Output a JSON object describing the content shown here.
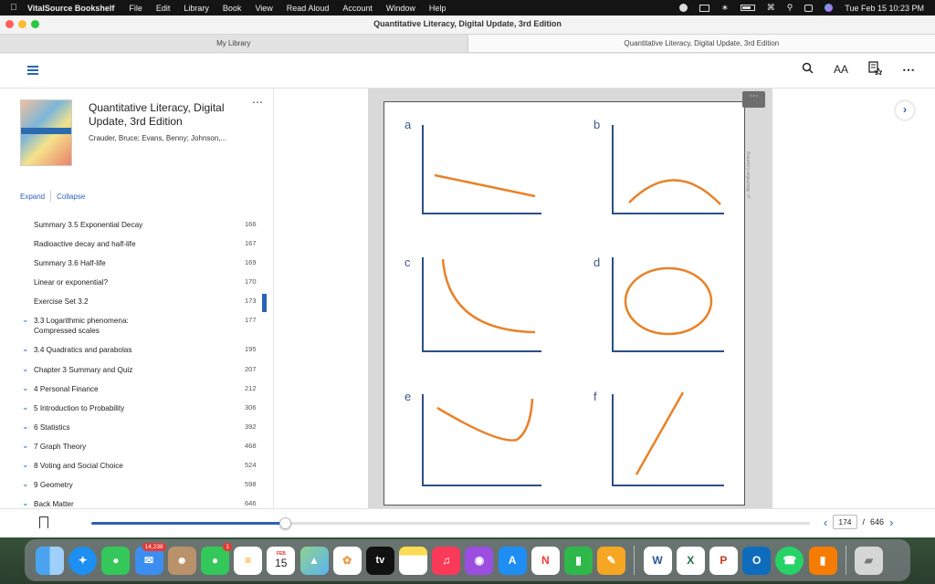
{
  "menubar": {
    "app_name": "VitalSource Bookshelf",
    "items": [
      "File",
      "Edit",
      "Library",
      "Book",
      "View",
      "Read Aloud",
      "Account",
      "Window",
      "Help"
    ],
    "clock": "Tue Feb 15  10:23 PM"
  },
  "window": {
    "title": "Quantitative Literacy, Digital Update,  3rd Edition"
  },
  "tabs": [
    {
      "label": "My Library"
    },
    {
      "label": "Quantitative Literacy, Digital Update,  3rd Edition"
    }
  ],
  "toolbar": {
    "search_icon": "search-icon",
    "font_label": "AA"
  },
  "sidebar": {
    "book_title": "Quantitative Literacy, Digital Update,  3rd Edition",
    "authors": "Crauder, Bruce; Evans, Benny; Johnson,...",
    "expand_label": "Expand",
    "collapse_label": "Collapse",
    "toc": [
      {
        "label": "Summary 3.5 Exponential Decay",
        "page": "166",
        "chevron": false
      },
      {
        "label": "Radioactive decay and half-life",
        "page": "167",
        "chevron": false
      },
      {
        "label": "Summary 3.6 Half-life",
        "page": "169",
        "chevron": false
      },
      {
        "label": "Linear or exponential?",
        "page": "170",
        "chevron": false
      },
      {
        "label": "Exercise Set 3.2",
        "page": "173",
        "chevron": false
      },
      {
        "label": "3.3 Logarithmic phenomena: Compressed scales",
        "page": "177",
        "chevron": true
      },
      {
        "label": "3.4 Quadratics and parabolas",
        "page": "195",
        "chevron": true
      },
      {
        "label": "Chapter 3 Summary and Quiz",
        "page": "207",
        "chevron": true
      },
      {
        "label": "4 Personal Finance",
        "page": "212",
        "chevron": true
      },
      {
        "label": "5 Introduction to Probability",
        "page": "306",
        "chevron": true
      },
      {
        "label": "6 Statistics",
        "page": "392",
        "chevron": true
      },
      {
        "label": "7 Graph Theory",
        "page": "468",
        "chevron": true
      },
      {
        "label": "8 Voting and Social Choice",
        "page": "524",
        "chevron": true
      },
      {
        "label": "9 Geometry",
        "page": "598",
        "chevron": true
      },
      {
        "label": "Back Matter",
        "page": "646",
        "chevron": true
      }
    ]
  },
  "reader": {
    "copyright": "© Macmillan Learning",
    "graph_labels": [
      "a",
      "b",
      "c",
      "d",
      "e",
      "f"
    ],
    "line_color": "#e8822a",
    "axis_color": "#2c4f86"
  },
  "progress": {
    "current_page": "174",
    "separator": "/",
    "total_pages": "646",
    "fraction": 0.27
  },
  "dock": {
    "mail_badge": "14,238",
    "messages_badge": "1",
    "calendar_month": "FEB",
    "calendar_day": "15",
    "tv_label": "tv"
  }
}
